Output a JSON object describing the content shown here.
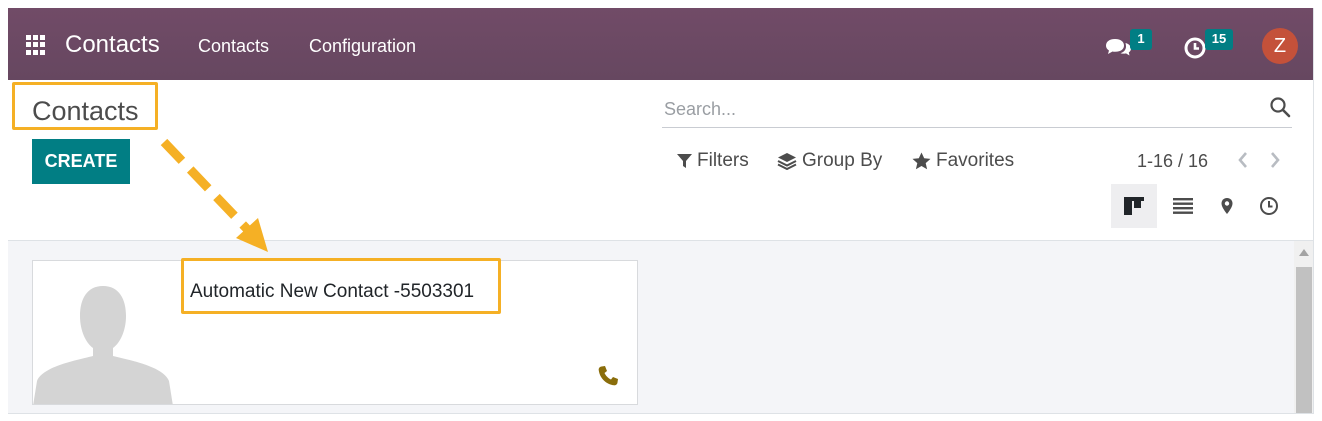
{
  "navbar": {
    "app_title": "Contacts",
    "menu": [
      "Contacts",
      "Configuration"
    ],
    "messages_badge": "1",
    "activities_badge": "15",
    "user_initial": "Z"
  },
  "control_panel": {
    "breadcrumb": "Contacts",
    "create_label": "CREATE",
    "search_placeholder": "Search...",
    "filters_label": "Filters",
    "groupby_label": "Group By",
    "favorites_label": "Favorites",
    "pager": "1-16 / 16",
    "views": [
      "kanban-view",
      "list-view",
      "map-view",
      "activity-view"
    ]
  },
  "kanban": {
    "cards": [
      {
        "name": "Automatic New Contact -5503301"
      }
    ]
  },
  "colors": {
    "navbar": "#714b67",
    "primary": "#017e84",
    "highlight": "#f5b025",
    "avatar": "#c4513a",
    "phone_icon": "#8a6d0b"
  },
  "icons": [
    "apps-grid-icon",
    "chat-icon",
    "clock-icon",
    "search-icon",
    "filter-icon",
    "layers-icon",
    "star-icon",
    "chevron-left-icon",
    "chevron-right-icon",
    "kanban-icon",
    "list-icon",
    "map-pin-icon",
    "activity-clock-icon",
    "phone-icon",
    "person-placeholder-icon"
  ]
}
